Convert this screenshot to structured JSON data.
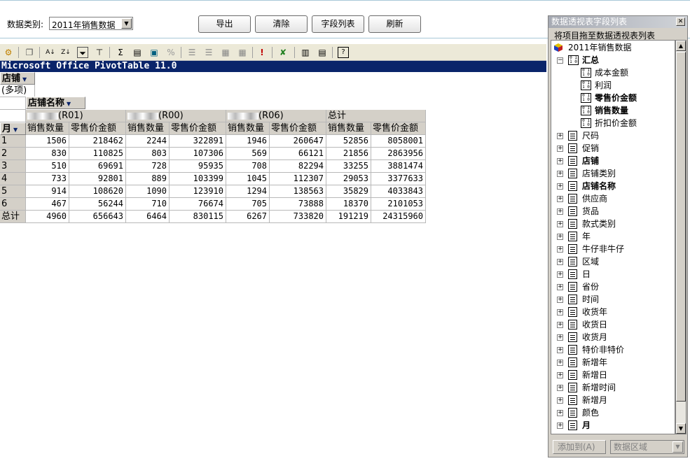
{
  "top": {
    "category_label": "数据类别:",
    "category_value": "2011年销售数据",
    "buttons": [
      "导出",
      "清除",
      "字段列表",
      "刷新"
    ]
  },
  "pivot": {
    "title": "Microsoft Office PivotTable 11.0",
    "page_field": "店铺",
    "page_value": "(多项)",
    "col_field": "店铺名称",
    "row_field": "月",
    "stores": [
      "(R01)",
      "(R00)",
      "(R06)"
    ],
    "total_label": "总计",
    "measures": [
      "销售数量",
      "零售价金额"
    ],
    "rows": [
      {
        "label": "1",
        "values": [
          "1506",
          "218462",
          "2244",
          "322891",
          "1946",
          "260647",
          "52856",
          "8058001"
        ]
      },
      {
        "label": "2",
        "values": [
          "830",
          "110825",
          "803",
          "107306",
          "569",
          "66121",
          "21856",
          "2863956"
        ]
      },
      {
        "label": "3",
        "values": [
          "510",
          "69691",
          "728",
          "95935",
          "708",
          "82294",
          "33255",
          "3881474"
        ]
      },
      {
        "label": "4",
        "values": [
          "733",
          "92801",
          "889",
          "103399",
          "1045",
          "112307",
          "29053",
          "3377633"
        ]
      },
      {
        "label": "5",
        "values": [
          "914",
          "108620",
          "1090",
          "123910",
          "1294",
          "138563",
          "35829",
          "4033843"
        ]
      },
      {
        "label": "6",
        "values": [
          "467",
          "56244",
          "710",
          "76674",
          "705",
          "73888",
          "18370",
          "2101053"
        ]
      }
    ],
    "grand_total": {
      "label": "总计",
      "values": [
        "4960",
        "656643",
        "6464",
        "830115",
        "6267",
        "733820",
        "191219",
        "24315960"
      ]
    }
  },
  "panel": {
    "title": "数据透视表字段列表",
    "hint": "将项目拖至数据透视表列表",
    "root": "2011年销售数据",
    "summary_group": "汇总",
    "data_fields": [
      {
        "label": "成本金额",
        "bold": false
      },
      {
        "label": "利润",
        "bold": false
      },
      {
        "label": "零售价金额",
        "bold": true
      },
      {
        "label": "销售数量",
        "bold": true
      },
      {
        "label": "折扣价金额",
        "bold": false
      }
    ],
    "fields": [
      {
        "label": "尺码",
        "bold": false
      },
      {
        "label": "促销",
        "bold": false
      },
      {
        "label": "店铺",
        "bold": true
      },
      {
        "label": "店铺类别",
        "bold": false
      },
      {
        "label": "店铺名称",
        "bold": true
      },
      {
        "label": "供应商",
        "bold": false
      },
      {
        "label": "货品",
        "bold": false
      },
      {
        "label": "款式类别",
        "bold": false
      },
      {
        "label": "年",
        "bold": false
      },
      {
        "label": "牛仔非牛仔",
        "bold": false
      },
      {
        "label": "区域",
        "bold": false
      },
      {
        "label": "日",
        "bold": false
      },
      {
        "label": "省份",
        "bold": false
      },
      {
        "label": "时间",
        "bold": false
      },
      {
        "label": "收货年",
        "bold": false
      },
      {
        "label": "收货日",
        "bold": false
      },
      {
        "label": "收货月",
        "bold": false
      },
      {
        "label": "特价非特价",
        "bold": false
      },
      {
        "label": "新增年",
        "bold": false
      },
      {
        "label": "新增日",
        "bold": false
      },
      {
        "label": "新增时间",
        "bold": false
      },
      {
        "label": "新增月",
        "bold": false
      },
      {
        "label": "颜色",
        "bold": false
      },
      {
        "label": "月",
        "bold": true
      }
    ],
    "add_button": "添加到(A)",
    "area_value": "数据区域"
  }
}
